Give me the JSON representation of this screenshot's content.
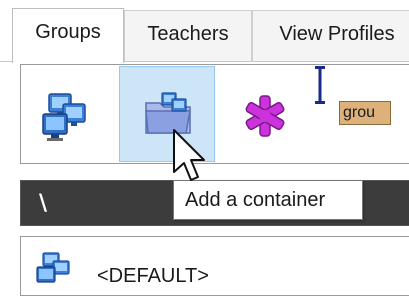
{
  "tabs": [
    {
      "label": "Groups",
      "active": true
    },
    {
      "label": "Teachers",
      "active": false
    },
    {
      "label": "View Profiles",
      "active": false
    }
  ],
  "toolbar": {
    "items": [
      {
        "icon": "computer-group-icon"
      },
      {
        "icon": "container-folder-icon",
        "hovered": true
      },
      {
        "icon": "asterisk-icon"
      },
      {
        "icon": "rename-icon",
        "text": "grou"
      }
    ]
  },
  "tooltip": "Add a container",
  "path": "\\",
  "list": {
    "items": [
      {
        "label": "<DEFAULT>",
        "icon": "computer-group-icon"
      }
    ]
  },
  "colors": {
    "hover_bg": "#cde6f7",
    "path_bg": "#3c3c3c",
    "asterisk": "#cc33dd",
    "rename_bg": "#ddb27a"
  }
}
